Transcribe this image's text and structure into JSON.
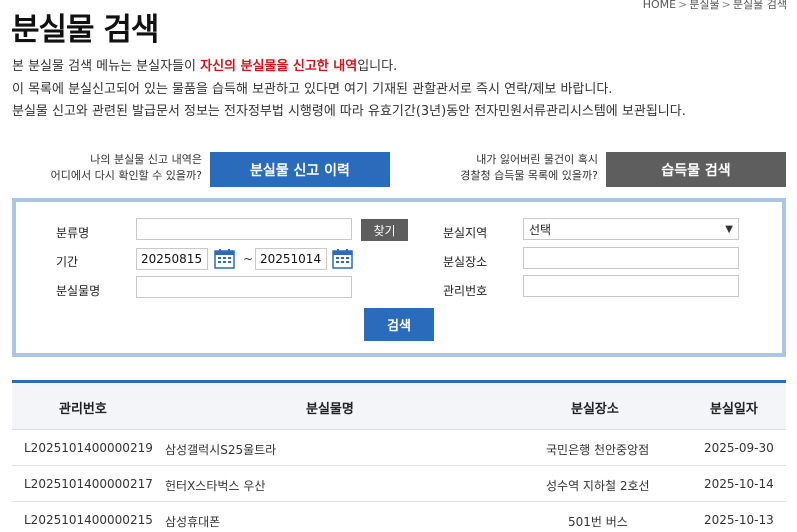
{
  "title": "분실물 검색",
  "breadcrumb": {
    "home": "HOME",
    "level1": "분실물",
    "level2": "분실물 검색"
  },
  "intro": {
    "line1_pre": "본 분실물 검색 메뉴는 분실자들이 ",
    "line1_highlight": "자신의 분실물을 신고한 내역",
    "line1_post": "입니다.",
    "line2": "이 목록에 분실신고되어 있는 물품을 습득해 보관하고 있다면 여기 기재된 관할관서로 즉시 연락/제보 바랍니다.",
    "line3": "분실물 신고와 관련된 발급문서 정보는 전자정부법 시행령에 따라 유효기간(3년)동안 전자민원서류관리시스템에 보관됩니다."
  },
  "quick": {
    "left_line1": "나의 분실물 신고 내역은",
    "left_line2": "어디에서 다시 확인할 수 있을까?",
    "history_button": "분실물 신고 이력",
    "right_line1": "내가 잃어버린 물건이 혹시",
    "right_line2": "경찰청 습득물 목록에 있을까?",
    "found_button": "습득물 검색"
  },
  "form": {
    "category_label": "분류명",
    "category_value": "",
    "find_button": "찾기",
    "period_label": "기간",
    "start_date": "20250815",
    "tilde": "~",
    "end_date": "20251014",
    "item_label": "분실물명",
    "item_value": "",
    "region_label": "분실지역",
    "region_selected": "선택",
    "place_label": "분실장소",
    "place_value": "",
    "manage_label": "관리번호",
    "manage_value": "",
    "search_button": "검색"
  },
  "table": {
    "headers": [
      "관리번호",
      "분실물명",
      "분실장소",
      "분실일자"
    ],
    "rows": [
      [
        "L2025101400000219",
        "삼성갤럭시S25울트라",
        "국민은행 천안중앙점",
        "2025-09-30"
      ],
      [
        "L2025101400000217",
        "헌터X스타벅스 우산",
        "성수역 지하철 2호선",
        "2025-10-14"
      ],
      [
        "L2025101400000215",
        "삼성휴대폰",
        "501번 버스",
        "2025-10-13"
      ]
    ]
  },
  "colors": {
    "primary_blue": "#2a6bbb",
    "dark_gray": "#5e5e5e",
    "highlight_red": "#d6131d",
    "box_border": "#a9c6e7"
  },
  "icons": {
    "calendar": "calendar-icon",
    "dropdown": "chevron-down-icon"
  }
}
